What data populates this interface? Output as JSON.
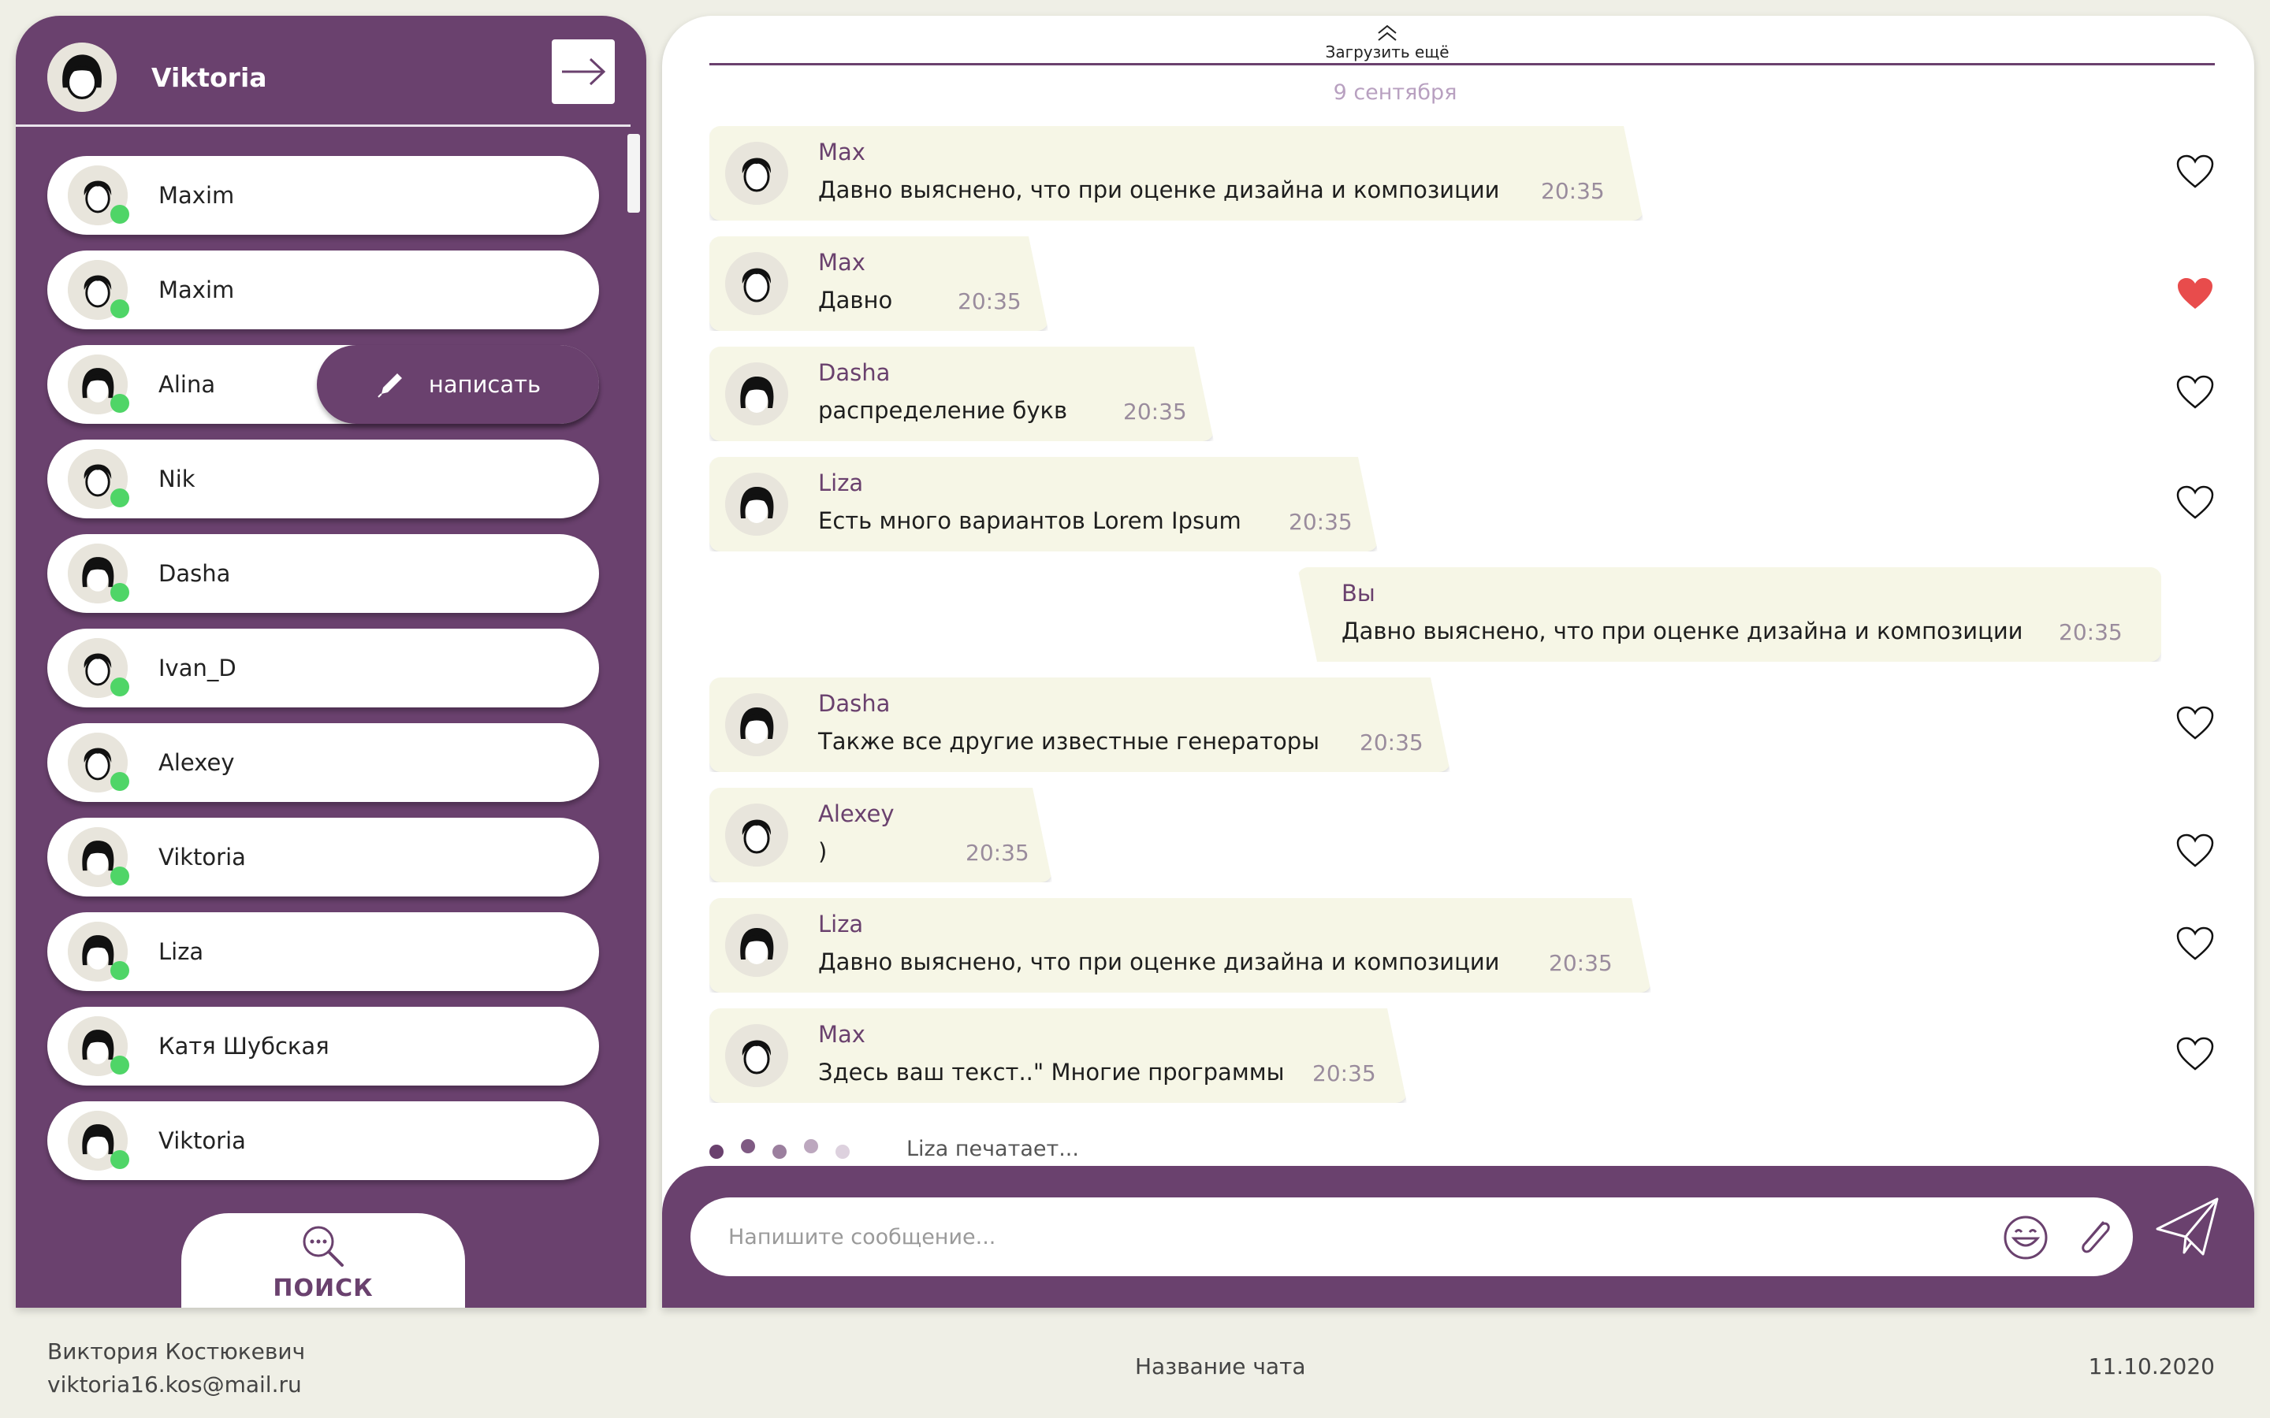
{
  "user": {
    "name": "Viktoria"
  },
  "contacts": [
    {
      "name": "Maxim",
      "avatar": "male-avatar-icon"
    },
    {
      "name": "Maxim",
      "avatar": "male-avatar-icon"
    },
    {
      "name": "Alina",
      "avatar": "female-avatar-icon",
      "action": "написать"
    },
    {
      "name": "Nik",
      "avatar": "male-avatar-icon"
    },
    {
      "name": "Dasha",
      "avatar": "female-avatar-icon"
    },
    {
      "name": "Ivan_D",
      "avatar": "male-avatar-icon"
    },
    {
      "name": "Alexey",
      "avatar": "male-avatar-icon"
    },
    {
      "name": "Viktoria",
      "avatar": "female-avatar-icon"
    },
    {
      "name": "Liza",
      "avatar": "female-avatar-icon"
    },
    {
      "name": "Катя Шубская",
      "avatar": "female-avatar-icon"
    },
    {
      "name": "Viktoria",
      "avatar": "female-avatar-icon"
    }
  ],
  "search": {
    "label": "ПОИСК"
  },
  "chat": {
    "load_more": "Загрузить ещё",
    "date": "9 сентября",
    "messages": [
      {
        "author": "Max",
        "text": "Давно выяснено, что при оценке дизайна и композиции",
        "time": "20:35",
        "liked": false
      },
      {
        "author": "Max",
        "text": "Давно",
        "time": "20:35",
        "liked": true
      },
      {
        "author": "Dasha",
        "text": "распределение букв",
        "time": "20:35",
        "liked": false
      },
      {
        "author": "Liza",
        "text": "Есть много вариантов Lorem Ipsum",
        "time": "20:35",
        "liked": false
      },
      {
        "author": "Вы",
        "text": "Давно выяснено, что при оценке дизайна и композиции",
        "time": "20:35",
        "mine": true
      },
      {
        "author": "Dasha",
        "text": "Также все другие известные генераторы",
        "time": "20:35",
        "liked": false
      },
      {
        "author": "Alexey",
        "text": ")",
        "time": "20:35",
        "liked": false
      },
      {
        "author": "Liza",
        "text": "Давно выяснено, что при оценке дизайна и композиции",
        "time": "20:35",
        "liked": false
      },
      {
        "author": "Max",
        "text": "Здесь ваш текст..\" Многие программы",
        "time": "20:35",
        "liked": false
      }
    ],
    "typing": "Liza печатает...",
    "input_placeholder": "Напишите сообщение..."
  },
  "footer": {
    "author": "Виктория Костюкевич",
    "email": "viktoria16.kos@mail.ru",
    "chat_title": "Название чата",
    "date": "11.10.2020"
  },
  "colors": {
    "accent": "#6a416e",
    "bubble": "#f6f6e6",
    "online": "#4fd567",
    "heart_active": "#e84c4c",
    "background": "#efefe6"
  },
  "icons": {
    "logout": "logout-arrow-icon",
    "write": "pencil-icon",
    "search": "search-icon",
    "like": "heart-icon",
    "emoji": "smile-icon",
    "attach": "paperclip-icon",
    "send": "send-icon"
  }
}
